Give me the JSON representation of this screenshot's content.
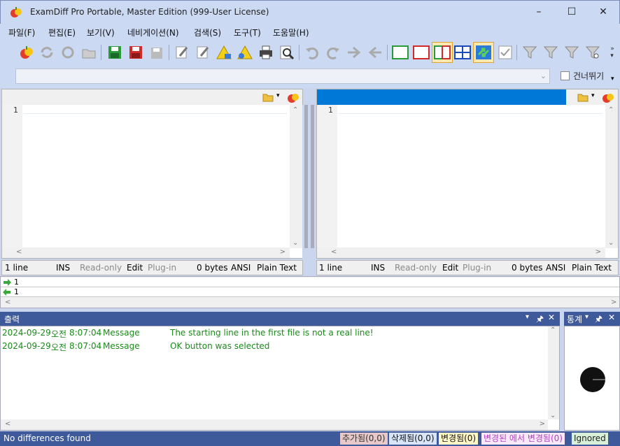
{
  "window": {
    "title": "ExamDiff Pro Portable, Master Edition (999-User License)"
  },
  "menu": [
    "파일(F)",
    "편집(E)",
    "보기(V)",
    "네비게이션(N)",
    "검색(S)",
    "도구(T)",
    "도움말(H)"
  ],
  "toolbar2": {
    "skip_label": "건너뛰기"
  },
  "left_pane": {
    "line_number": "1",
    "status": {
      "lines": "1 line",
      "mode": "INS",
      "readonly": "Read-only",
      "edit": "Edit",
      "plugin": "Plug-in",
      "size": "0 bytes",
      "encoding": "ANSI",
      "type": "Plain Text"
    }
  },
  "right_pane": {
    "line_number": "1",
    "status": {
      "lines": "1 line",
      "mode": "INS",
      "readonly": "Read-only",
      "edit": "Edit",
      "plugin": "Plug-in",
      "size": "0 bytes",
      "encoding": "ANSI",
      "type": "Plain Text"
    }
  },
  "diffbar": {
    "row1": "1",
    "row2": "1"
  },
  "output": {
    "title": "출력",
    "rows": [
      {
        "date": "2024-09-29",
        "ampm": "오전",
        "time": "8:07:04",
        "kind": "Message",
        "text": "The starting line in the first file is not a real line!"
      },
      {
        "date": "2024-09-29",
        "ampm": "오전",
        "time": "8:07:04",
        "kind": "Message",
        "text": "OK button was selected"
      }
    ]
  },
  "stats": {
    "title": "통계"
  },
  "statusbar": {
    "message": "No differences found",
    "added": "추가됨(0,0)",
    "deleted": "삭제됨(0,0)",
    "changed": "변경됨(0)",
    "changed_in_changed": "변경된 에서 변경됨(0)",
    "ignored": "Ignored"
  },
  "colors": {
    "accent": "#3f5a9a",
    "right_header": "#0078d7",
    "added_bg": "#e8c8c8",
    "deleted_bg": "#d8e4f8",
    "changed_bg": "#fff6c8",
    "changed_in_bg": "#f8e8f8",
    "ignored_bg": "#d8f0d8"
  }
}
